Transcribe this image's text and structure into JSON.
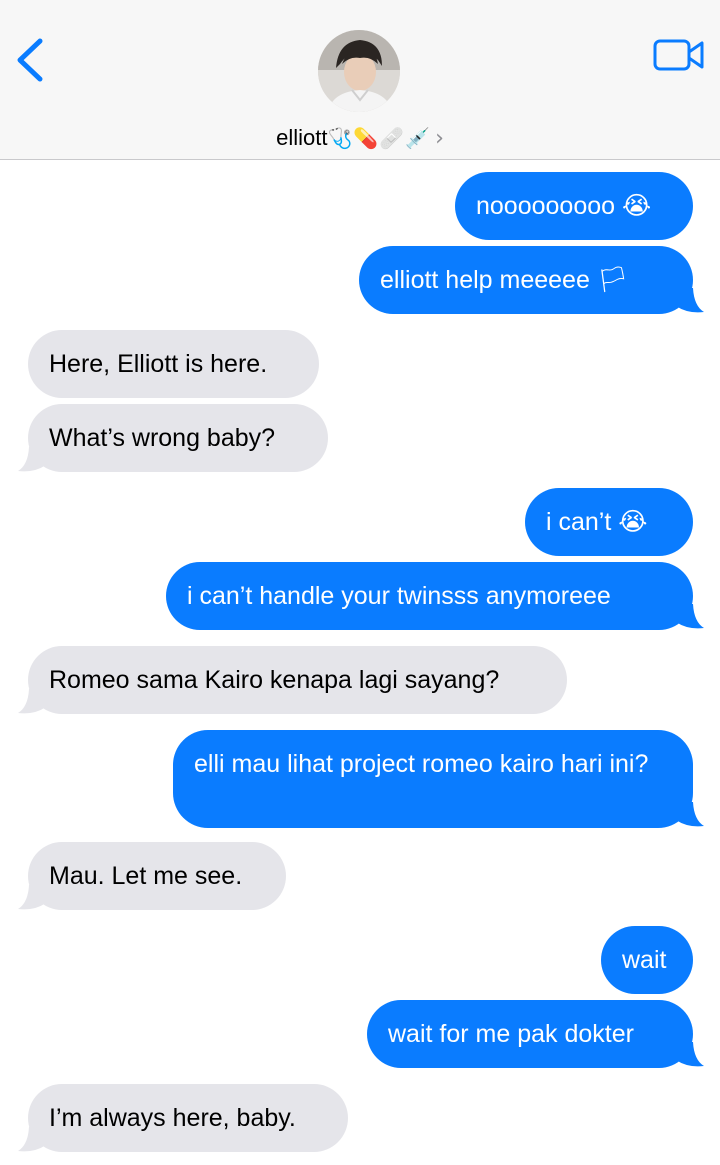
{
  "header": {
    "back_icon": "chevron-left-icon",
    "contact_name": "elliott",
    "contact_emoji": "🩺💊🩹💉",
    "chevron": "›",
    "video_icon": "video-camera-icon",
    "accent_color": "#0a7cff"
  },
  "messages": [
    {
      "from": "me",
      "text": "nooooooooo",
      "emoji": "😭"
    },
    {
      "from": "me",
      "text": "elliott help meeeee",
      "emoji": "🏳"
    },
    {
      "from": "contact",
      "text": "Here, Elliott is here."
    },
    {
      "from": "contact",
      "text": "What’s wrong baby?"
    },
    {
      "from": "me",
      "text": "i can’t",
      "emoji": "😭"
    },
    {
      "from": "me",
      "text": "i can’t handle your twinsss anymoreee"
    },
    {
      "from": "contact",
      "text": "Romeo sama Kairo kenapa lagi sayang?"
    },
    {
      "from": "me",
      "text": "elli mau lihat project romeo kairo hari ini?"
    },
    {
      "from": "contact",
      "text": "Mau. Let me see."
    },
    {
      "from": "me",
      "text": "wait"
    },
    {
      "from": "me",
      "text": "wait for me pak dokter"
    },
    {
      "from": "contact",
      "text": "I’m always here, baby."
    }
  ],
  "colors": {
    "sent_bubble": "#0a7cff",
    "received_bubble": "#e5e5ea",
    "header_bg": "#f7f7f7"
  }
}
